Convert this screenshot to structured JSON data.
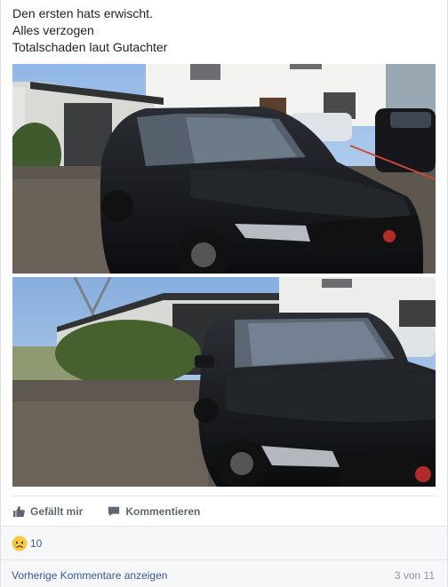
{
  "post": {
    "lines": [
      "Den ersten hats erwischt.",
      "Alles verzogen",
      "Totalschaden laut Gutachter"
    ]
  },
  "photos": [
    {
      "name": "car-photo-front-three-quarter"
    },
    {
      "name": "car-photo-front-close"
    }
  ],
  "actions": {
    "like_label": "Gefällt mir",
    "comment_label": "Kommentieren",
    "like_icon": "thumbs-up-icon",
    "comment_icon": "comment-icon"
  },
  "reactions": {
    "icon": "sad-reaction-icon",
    "count": "10"
  },
  "comments": {
    "previous_label": "Vorherige Kommentare anzeigen",
    "page_count": "3 von 11"
  },
  "colors": {
    "link": "#385898",
    "muted": "#90949c",
    "action_text": "#606770"
  }
}
